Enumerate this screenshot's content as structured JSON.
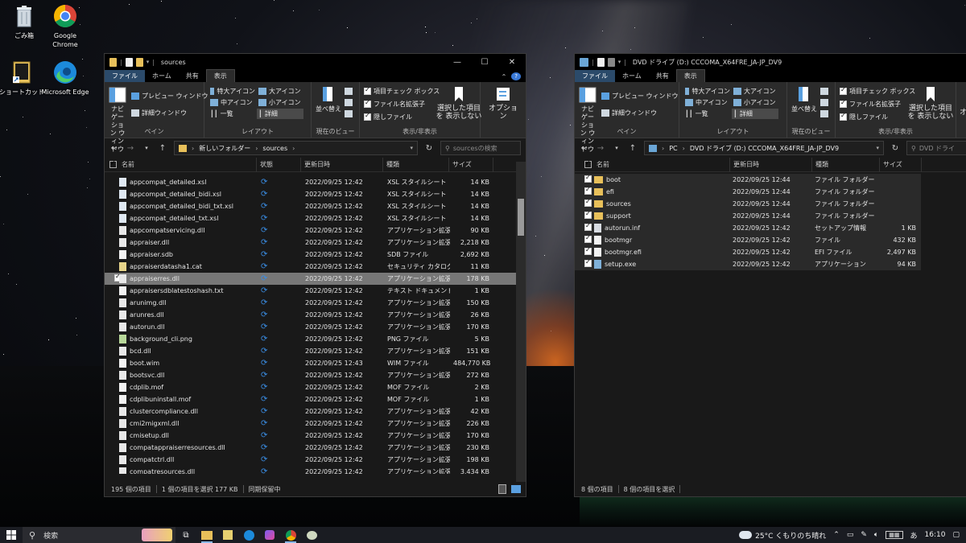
{
  "desktop": {
    "icons": [
      {
        "label": "ごみ箱",
        "icon": "recycle-bin-icon"
      },
      {
        "label": "Google Chrome",
        "icon": "chrome-icon"
      },
      {
        "label": "ショートカット",
        "icon": "shortcut-icon"
      },
      {
        "label": "Microsoft Edge",
        "icon": "edge-icon"
      }
    ]
  },
  "left_window": {
    "title": "sources",
    "tabs": [
      "ファイル",
      "ホーム",
      "共有",
      "表示"
    ],
    "ribbon": {
      "pane": {
        "nav_pane": "ナビゲーション ウィンドウ",
        "preview_pane": "プレビュー ウィンドウ",
        "details_pane": "詳細ウィンドウ",
        "group": "ペイン"
      },
      "layout": {
        "xl_icons": "特大アイコン",
        "l_icons": "大アイコン",
        "m_icons": "中アイコン",
        "s_icons": "小アイコン",
        "list": "一覧",
        "details": "詳細",
        "group": "レイアウト"
      },
      "current_view": {
        "sort": "並べ替え",
        "group": "現在のビュー"
      },
      "show_hide": {
        "item_checkbox": "項目チェック ボックス",
        "file_ext": "ファイル名拡張子",
        "hidden": "隠しファイル",
        "hide_selected": "選択した項目を 表示しない",
        "group": "表示/非表示"
      },
      "options": "オプション"
    },
    "address": {
      "path": [
        "新しいフォルダー",
        "sources"
      ],
      "search_placeholder": "sourcesの検索"
    },
    "columns": [
      "名前",
      "状態",
      "更新日時",
      "種類",
      "サイズ"
    ],
    "files": [
      {
        "name": "appcompat_detailed.xsl",
        "date": "2022/09/25 12:42",
        "type": "XSL スタイルシート",
        "size": "14 KB",
        "icon": "xsl"
      },
      {
        "name": "appcompat_detailed_bidi.xsl",
        "date": "2022/09/25 12:42",
        "type": "XSL スタイルシート",
        "size": "14 KB",
        "icon": "xsl"
      },
      {
        "name": "appcompat_detailed_bidi_txt.xsl",
        "date": "2022/09/25 12:42",
        "type": "XSL スタイルシート",
        "size": "14 KB",
        "icon": "xsl"
      },
      {
        "name": "appcompat_detailed_txt.xsl",
        "date": "2022/09/25 12:42",
        "type": "XSL スタイルシート",
        "size": "14 KB",
        "icon": "xsl"
      },
      {
        "name": "appcompatservicing.dll",
        "date": "2022/09/25 12:42",
        "type": "アプリケーション拡張",
        "size": "90 KB",
        "icon": "dll"
      },
      {
        "name": "appraiser.dll",
        "date": "2022/09/25 12:42",
        "type": "アプリケーション拡張",
        "size": "2,218 KB",
        "icon": "dll"
      },
      {
        "name": "appraiser.sdb",
        "date": "2022/09/25 12:42",
        "type": "SDB ファイル",
        "size": "2,692 KB",
        "icon": "doc"
      },
      {
        "name": "appraiserdatasha1.cat",
        "date": "2022/09/25 12:42",
        "type": "セキュリティ カタログ",
        "size": "11 KB",
        "icon": "cat"
      },
      {
        "name": "appraiserres.dll",
        "date": "2022/09/25 12:42",
        "type": "アプリケーション拡張",
        "size": "178 KB",
        "icon": "dll",
        "selected": true
      },
      {
        "name": "appraisersdblatestoshash.txt",
        "date": "2022/09/25 12:42",
        "type": "テキスト ドキュメント",
        "size": "1 KB",
        "icon": "doc"
      },
      {
        "name": "arunimg.dll",
        "date": "2022/09/25 12:42",
        "type": "アプリケーション拡張",
        "size": "150 KB",
        "icon": "dll"
      },
      {
        "name": "arunres.dll",
        "date": "2022/09/25 12:42",
        "type": "アプリケーション拡張",
        "size": "26 KB",
        "icon": "dll"
      },
      {
        "name": "autorun.dll",
        "date": "2022/09/25 12:42",
        "type": "アプリケーション拡張",
        "size": "170 KB",
        "icon": "dll"
      },
      {
        "name": "background_cli.png",
        "date": "2022/09/25 12:42",
        "type": "PNG ファイル",
        "size": "5 KB",
        "icon": "png"
      },
      {
        "name": "bcd.dll",
        "date": "2022/09/25 12:42",
        "type": "アプリケーション拡張",
        "size": "151 KB",
        "icon": "dll"
      },
      {
        "name": "boot.wim",
        "date": "2022/09/25 12:43",
        "type": "WIM ファイル",
        "size": "484,770 KB",
        "icon": "doc"
      },
      {
        "name": "bootsvc.dll",
        "date": "2022/09/25 12:42",
        "type": "アプリケーション拡張",
        "size": "272 KB",
        "icon": "dll"
      },
      {
        "name": "cdplib.mof",
        "date": "2022/09/25 12:42",
        "type": "MOF ファイル",
        "size": "2 KB",
        "icon": "doc"
      },
      {
        "name": "cdplibuninstall.mof",
        "date": "2022/09/25 12:42",
        "type": "MOF ファイル",
        "size": "1 KB",
        "icon": "doc"
      },
      {
        "name": "clustercompliance.dll",
        "date": "2022/09/25 12:42",
        "type": "アプリケーション拡張",
        "size": "42 KB",
        "icon": "dll"
      },
      {
        "name": "cmi2migxml.dll",
        "date": "2022/09/25 12:42",
        "type": "アプリケーション拡張",
        "size": "226 KB",
        "icon": "dll"
      },
      {
        "name": "cmisetup.dll",
        "date": "2022/09/25 12:42",
        "type": "アプリケーション拡張",
        "size": "170 KB",
        "icon": "dll"
      },
      {
        "name": "compatappraiserresources.dll",
        "date": "2022/09/25 12:42",
        "type": "アプリケーション拡張",
        "size": "230 KB",
        "icon": "dll"
      },
      {
        "name": "compatctrl.dll",
        "date": "2022/09/25 12:42",
        "type": "アプリケーション拡張",
        "size": "198 KB",
        "icon": "dll"
      },
      {
        "name": "compatresources.dll",
        "date": "2022/09/25 12:42",
        "type": "アプリケーション拡張",
        "size": "3,434 KB",
        "icon": "dll"
      }
    ],
    "status": {
      "count": "195 個の項目",
      "selection": "1 個の項目を選択 177 KB",
      "sync": "同期保留中"
    }
  },
  "right_window": {
    "title": "DVD ドライブ (D:) CCCOMA_X64FRE_JA-JP_DV9",
    "tabs": [
      "ファイル",
      "ホーム",
      "共有",
      "表示"
    ],
    "ribbon": {
      "pane": {
        "nav_pane": "ナビゲーション ウィンドウ",
        "preview_pane": "プレビュー ウィンドウ",
        "details_pane": "詳細ウィンドウ",
        "group": "ペイン"
      },
      "layout": {
        "xl_icons": "特大アイコン",
        "l_icons": "大アイコン",
        "m_icons": "中アイコン",
        "s_icons": "小アイコン",
        "list": "一覧",
        "details": "詳細",
        "group": "レイアウト"
      },
      "current_view": {
        "sort": "並べ替え",
        "group": "現在のビュー"
      },
      "show_hide": {
        "item_checkbox": "項目チェック ボックス",
        "file_ext": "ファイル名拡張子",
        "hidden": "隠しファイル",
        "hide_selected": "選択した項目を 表示しない",
        "group": "表示/非表示"
      },
      "options": "オ"
    },
    "address": {
      "path": [
        "PC",
        "DVD ドライブ (D:) CCCOMA_X64FRE_JA-JP_DV9"
      ],
      "search_placeholder": "DVD ドライ"
    },
    "columns": [
      "名前",
      "更新日時",
      "種類",
      "サイズ"
    ],
    "files": [
      {
        "name": "boot",
        "date": "2022/09/25 12:44",
        "type": "ファイル フォルダー",
        "size": "",
        "icon": "folder"
      },
      {
        "name": "efi",
        "date": "2022/09/25 12:44",
        "type": "ファイル フォルダー",
        "size": "",
        "icon": "folder"
      },
      {
        "name": "sources",
        "date": "2022/09/25 12:44",
        "type": "ファイル フォルダー",
        "size": "",
        "icon": "folder"
      },
      {
        "name": "support",
        "date": "2022/09/25 12:44",
        "type": "ファイル フォルダー",
        "size": "",
        "icon": "folder"
      },
      {
        "name": "autorun.inf",
        "date": "2022/09/25 12:42",
        "type": "セットアップ情報",
        "size": "1 KB",
        "icon": "inf"
      },
      {
        "name": "bootmgr",
        "date": "2022/09/25 12:42",
        "type": "ファイル",
        "size": "432 KB",
        "icon": "doc"
      },
      {
        "name": "bootmgr.efi",
        "date": "2022/09/25 12:42",
        "type": "EFI ファイル",
        "size": "2,497 KB",
        "icon": "doc"
      },
      {
        "name": "setup.exe",
        "date": "2022/09/25 12:42",
        "type": "アプリケーション",
        "size": "94 KB",
        "icon": "exe"
      }
    ],
    "status": {
      "count": "8 個の項目",
      "selection": "8 個の項目を選択"
    }
  },
  "taskbar": {
    "search_label": "検索",
    "weather": "25°C くもりのち晴れ",
    "ime": "あ",
    "time": "16:10"
  },
  "colors": {
    "accent": "#2b4a6a",
    "sync_blue": "#3a8ee6",
    "folder": "#e8c05a",
    "selected_row": "#777777"
  }
}
